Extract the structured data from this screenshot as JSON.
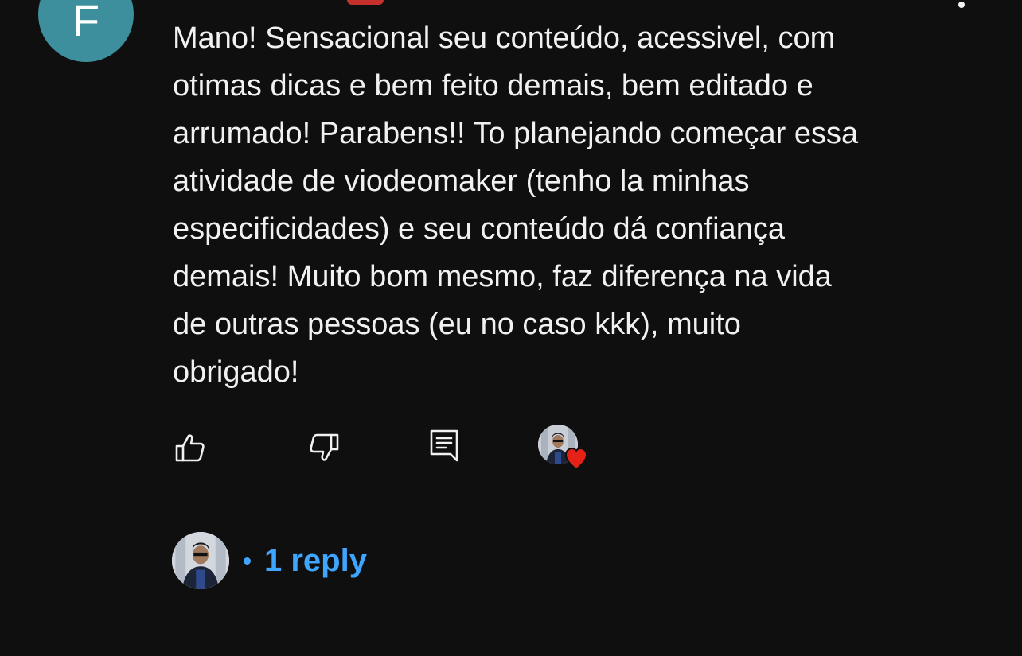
{
  "comment": {
    "author_initial": "F",
    "text": "Mano! Sensacional seu conteúdo, acessivel, com\notimas dicas e bem feito demais, bem editado e\narrumado! Parabens!! To planejando começar essa\natividade de viodeomaker (tenho la minhas\nespecificidades) e seu conteúdo dá confiança\ndemais! Muito bom mesmo, faz diferença na vida\nde outras pessoas (eu no caso kkk), muito\nobrigado!"
  },
  "actions": {
    "like_icon": "thumbs-up-icon",
    "dislike_icon": "thumbs-down-icon",
    "reply_icon": "comment-reply-icon",
    "creator_heart_icon": "heart-icon"
  },
  "replies": {
    "count_label": "1 reply"
  },
  "colors": {
    "background": "#0f0f0f",
    "text": "#f1f1f1",
    "avatar": "#3e8f9e",
    "link": "#3ea6ff",
    "heart": "#e62117"
  }
}
